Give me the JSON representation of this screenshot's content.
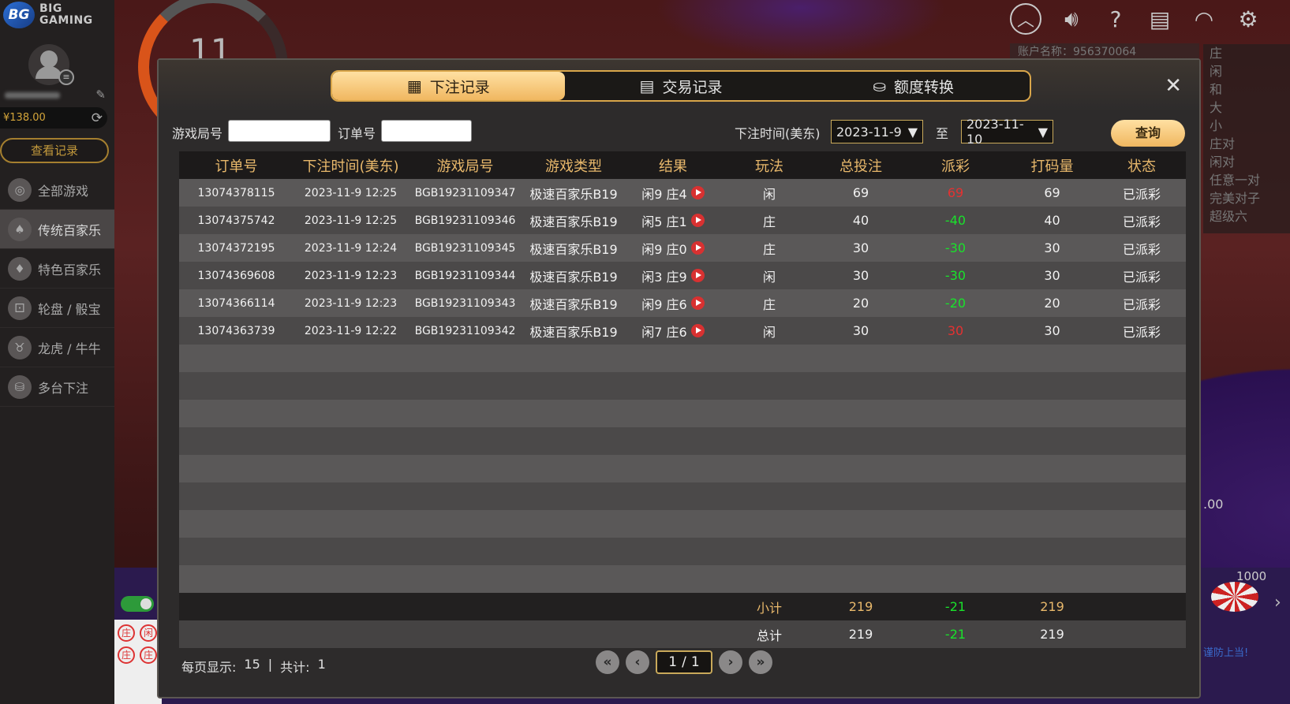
{
  "brand": {
    "mark": "BG",
    "line1": "BIG",
    "line2": "GAMING"
  },
  "scene": {
    "timer": "11",
    "account_label": "账户名称：956370064",
    "right_panel": [
      "庄",
      "闲",
      "和",
      "大",
      "小",
      "庄对",
      "闲对",
      "任意一对",
      "完美对子",
      "超级六"
    ],
    "chip_value": "1000",
    "amount_text": ".00",
    "warning": "谨防上当!",
    "bigroad": [
      "庄",
      "闲",
      "庄",
      "庄"
    ]
  },
  "sidebar": {
    "balance": "¥138.00",
    "view_records": "查看记录",
    "items": [
      {
        "label": "全部游戏",
        "icon": "all-games-icon",
        "glyph": "◎",
        "active": false
      },
      {
        "label": "传统百家乐",
        "icon": "baccarat-cards-icon",
        "glyph": "♠",
        "active": true
      },
      {
        "label": "特色百家乐",
        "icon": "special-baccarat-icon",
        "glyph": "♦",
        "active": false
      },
      {
        "label": "轮盘 / 骰宝",
        "icon": "roulette-dice-icon",
        "glyph": "⚀",
        "active": false
      },
      {
        "label": "龙虎 / 牛牛",
        "icon": "bull-icon",
        "glyph": "♉",
        "active": false
      },
      {
        "label": "多台下注",
        "icon": "multi-table-icon",
        "glyph": "⛁",
        "active": false
      }
    ]
  },
  "modal": {
    "tabs": [
      {
        "label": "下注记录",
        "icon": "calendar-icon",
        "glyph": "▦",
        "active": true
      },
      {
        "label": "交易记录",
        "icon": "clipboard-icon",
        "glyph": "▤",
        "active": false
      },
      {
        "label": "额度转换",
        "icon": "coins-icon",
        "glyph": "⛀",
        "active": false
      }
    ],
    "close": "✕",
    "filter": {
      "round_label": "游戏局号",
      "round_value": "",
      "order_label": "订单号",
      "order_value": "",
      "time_label": "下注时间(美东)",
      "date_from": "2023-11-9",
      "to_label": "至",
      "date_to": "2023-11-10",
      "query": "查询"
    },
    "columns": [
      "订单号",
      "下注时间(美东)",
      "游戏局号",
      "游戏类型",
      "结果",
      "玩法",
      "总投注",
      "派彩",
      "打码量",
      "状态"
    ],
    "rows": [
      {
        "order": "13074378115",
        "time": "2023-11-9 12:25",
        "round": "BGB19231109347",
        "game": "极速百家乐B19",
        "result": "闲9 庄4",
        "play": "闲",
        "bet": "69",
        "payout": "69",
        "payout_sign": "win",
        "turnover": "69",
        "status": "已派彩"
      },
      {
        "order": "13074375742",
        "time": "2023-11-9 12:25",
        "round": "BGB19231109346",
        "game": "极速百家乐B19",
        "result": "闲5 庄1",
        "play": "庄",
        "bet": "40",
        "payout": "-40",
        "payout_sign": "lose",
        "turnover": "40",
        "status": "已派彩"
      },
      {
        "order": "13074372195",
        "time": "2023-11-9 12:24",
        "round": "BGB19231109345",
        "game": "极速百家乐B19",
        "result": "闲9 庄0",
        "play": "庄",
        "bet": "30",
        "payout": "-30",
        "payout_sign": "lose",
        "turnover": "30",
        "status": "已派彩"
      },
      {
        "order": "13074369608",
        "time": "2023-11-9 12:23",
        "round": "BGB19231109344",
        "game": "极速百家乐B19",
        "result": "闲3 庄9",
        "play": "闲",
        "bet": "30",
        "payout": "-30",
        "payout_sign": "lose",
        "turnover": "30",
        "status": "已派彩"
      },
      {
        "order": "13074366114",
        "time": "2023-11-9 12:23",
        "round": "BGB19231109343",
        "game": "极速百家乐B19",
        "result": "闲9 庄6",
        "play": "庄",
        "bet": "20",
        "payout": "-20",
        "payout_sign": "lose",
        "turnover": "20",
        "status": "已派彩"
      },
      {
        "order": "13074363739",
        "time": "2023-11-9 12:22",
        "round": "BGB19231109342",
        "game": "极速百家乐B19",
        "result": "闲7 庄6",
        "play": "闲",
        "bet": "30",
        "payout": "30",
        "payout_sign": "win",
        "turnover": "30",
        "status": "已派彩"
      }
    ],
    "empty_rows": 9,
    "subtotal": {
      "label": "小计",
      "bet": "219",
      "payout": "-21",
      "turnover": "219"
    },
    "total": {
      "label": "总计",
      "bet": "219",
      "payout": "-21",
      "turnover": "219"
    },
    "footer": {
      "per_page_label": "每页显示:",
      "per_page": "15",
      "sep": "|",
      "total_label": "共计:",
      "total": "1"
    },
    "pager": {
      "current": "1",
      "slash": "/",
      "pages": "1"
    }
  },
  "colors": {
    "accent": "#f0b760",
    "win": "#e53131",
    "lose": "#19e22b",
    "header_text": "#e8b86b"
  }
}
